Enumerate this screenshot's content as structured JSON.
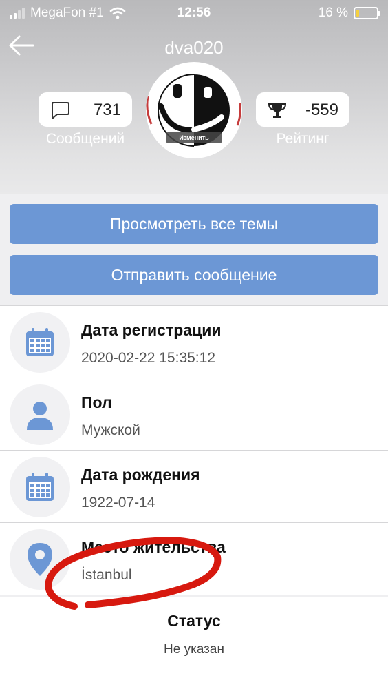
{
  "status_bar": {
    "carrier": "MegaFon #1",
    "time": "12:56",
    "battery": "16 %",
    "battery_level": 0.16
  },
  "header": {
    "username": "dva020",
    "messages": {
      "count": "731",
      "label": "Сообщений"
    },
    "rating": {
      "value": "-559",
      "label": "Рейтинг"
    },
    "avatar_edit_label": "Изменить"
  },
  "actions": {
    "view_topics": "Просмотреть все темы",
    "send_message": "Отправить сообщение"
  },
  "profile": [
    {
      "title": "Дата регистрации",
      "value": "2020-02-22 15:35:12",
      "icon": "calendar-icon"
    },
    {
      "title": "Пол",
      "value": "Мужской",
      "icon": "person-icon"
    },
    {
      "title": "Дата рождения",
      "value": "1922-07-14",
      "icon": "calendar-icon"
    },
    {
      "title": "Место жительства",
      "value": "İstanbul",
      "icon": "location-pin-icon"
    }
  ],
  "status": {
    "title": "Статус",
    "value": "Не указан"
  },
  "colors": {
    "accent": "#6c97d5",
    "annotation": "#d7190f",
    "battery": "#f4d03f"
  }
}
